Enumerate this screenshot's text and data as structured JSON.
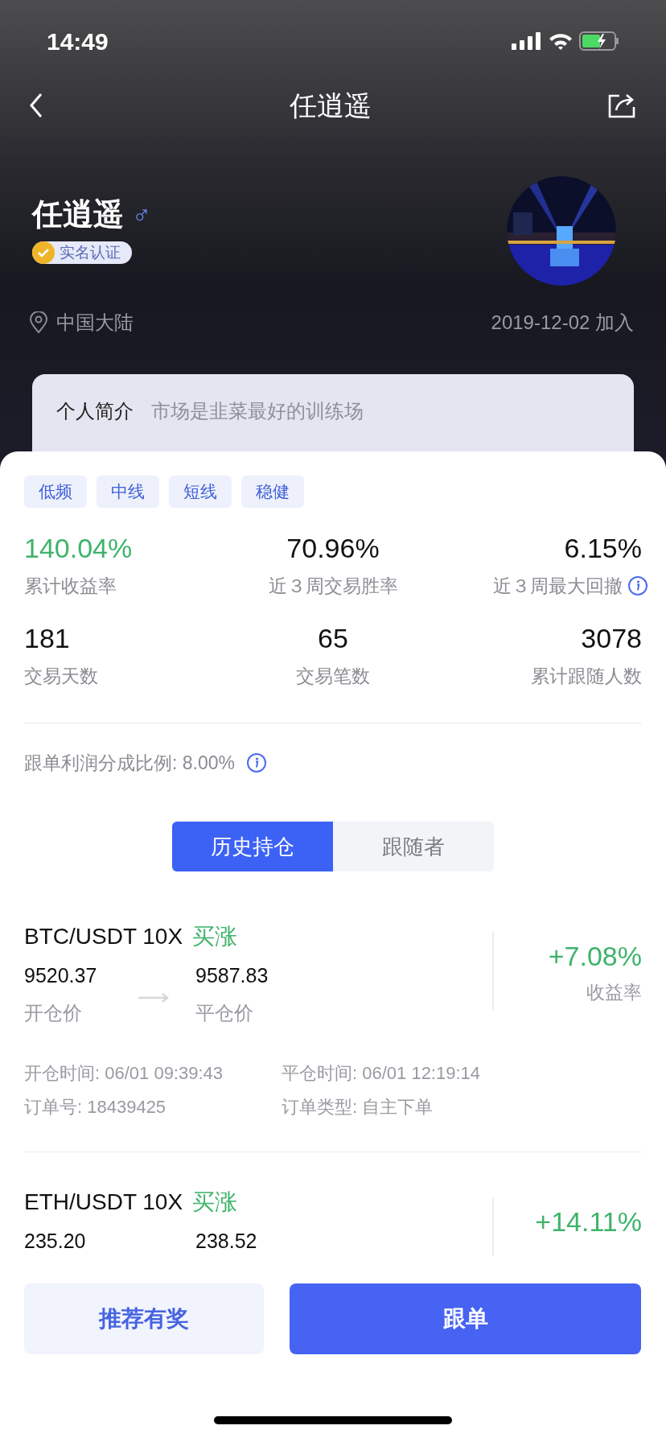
{
  "status_bar": {
    "time": "14:49"
  },
  "nav": {
    "title": "任逍遥"
  },
  "profile": {
    "name": "任逍遥",
    "gender_sign": "♂",
    "verified": true,
    "verified_label": "实名认证",
    "location": "中国大陆",
    "joined": "2019-12-02 加入",
    "bio_label": "个人简介",
    "bio": "市场是韭菜最好的训练场"
  },
  "tags": [
    "低频",
    "中线",
    "短线",
    "稳健"
  ],
  "stats": [
    {
      "value": "140.04%",
      "label": "累计收益率",
      "kind": "positive",
      "info": false
    },
    {
      "value": "70.96%",
      "label": "近３周交易胜率",
      "kind": "plain",
      "info": false
    },
    {
      "value": "6.15%",
      "label": "近３周最大回撤",
      "kind": "plain",
      "info": true
    },
    {
      "value": "181",
      "label": "交易天数",
      "kind": "plain",
      "info": false
    },
    {
      "value": "65",
      "label": "交易笔数",
      "kind": "plain",
      "info": false
    },
    {
      "value": "3078",
      "label": "累计跟随人数",
      "kind": "plain",
      "info": false
    }
  ],
  "share_ratio": {
    "text": "跟单利润分成比例: 8.00%",
    "info": true
  },
  "tabs": [
    {
      "label": "历史持仓",
      "selected": true
    },
    {
      "label": "跟随者",
      "selected": false
    }
  ],
  "positions": [
    {
      "pair": "BTC/USDT 10X",
      "side": "买涨",
      "open_price": "9520.37",
      "open_label": "开仓价",
      "close_price": "9587.83",
      "close_label": "平仓价",
      "profit": "+7.08%",
      "profit_label": "收益率",
      "open_time": "开仓时间: 06/01 09:39:43",
      "close_time": "平仓时间: 06/01 12:19:14",
      "order_no": "订单号: 18439425",
      "order_type": "订单类型: 自主下单"
    },
    {
      "pair": "ETH/USDT 10X",
      "side": "买涨",
      "open_price": "235.20",
      "close_price": "238.52",
      "profit": "+14.11%"
    }
  ],
  "buttons": [
    {
      "label": "推荐有奖",
      "kind": "secondary"
    },
    {
      "label": "跟单",
      "kind": "primary"
    }
  ]
}
